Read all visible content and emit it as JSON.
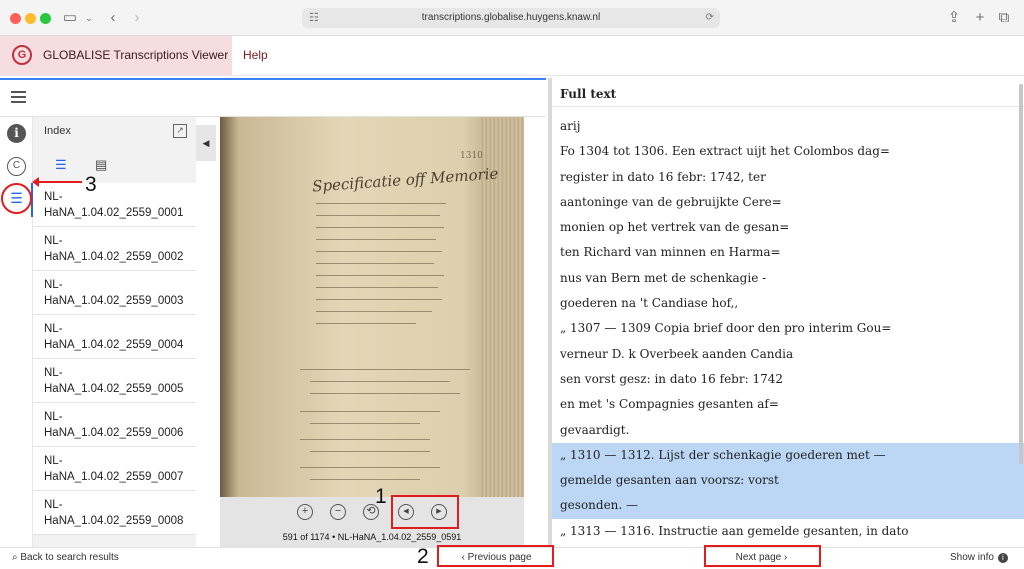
{
  "browser": {
    "url": "transcriptions.globalise.huygens.knaw.nl"
  },
  "app": {
    "title": "GLOBALISE Transcriptions Viewer",
    "logo_letter": "G",
    "help_label": "Help"
  },
  "index_panel": {
    "title": "Index",
    "items": [
      {
        "line1": "NL-",
        "line2": "HaNA_1.04.02_2559_0001"
      },
      {
        "line1": "NL-",
        "line2": "HaNA_1.04.02_2559_0002"
      },
      {
        "line1": "NL-",
        "line2": "HaNA_1.04.02_2559_0003"
      },
      {
        "line1": "NL-",
        "line2": "HaNA_1.04.02_2559_0004"
      },
      {
        "line1": "NL-",
        "line2": "HaNA_1.04.02_2559_0005"
      },
      {
        "line1": "NL-",
        "line2": "HaNA_1.04.02_2559_0006"
      },
      {
        "line1": "NL-",
        "line2": "HaNA_1.04.02_2559_0007"
      },
      {
        "line1": "NL-",
        "line2": "HaNA_1.04.02_2559_0008"
      }
    ]
  },
  "viewer": {
    "page_number_on_scan": "1310",
    "scan_heading": "Specificatie off Memorie",
    "caption": "591 of 1174 • NL-HaNA_1.04.02_2559_0591",
    "controls": {
      "zoom_in": "+",
      "zoom_out": "−",
      "reset": "⟲",
      "prev": "◀",
      "next": "▶"
    }
  },
  "full_text": {
    "title": "Full text",
    "lines": [
      {
        "text": "arij",
        "highlight": false
      },
      {
        "text": "Fo 1304 tot 1306. Een extract uijt het Colombos dag=",
        "highlight": false
      },
      {
        "text": "register in dato 16 febr: 1742, ter",
        "highlight": false
      },
      {
        "text": "aantoninge van de gebruijkte Cere=",
        "highlight": false
      },
      {
        "text": "monien op het vertrek van de gesan=",
        "highlight": false
      },
      {
        "text": "ten Richard van minnen en Harma=",
        "highlight": false
      },
      {
        "text": "nus van Bern met de schenkagie -",
        "highlight": false
      },
      {
        "text": "goederen na 't Candiase hof,,",
        "highlight": false
      },
      {
        "text": "„ 1307 — 1309 Copia brief door den pro interim Gou=",
        "highlight": false
      },
      {
        "text": "verneur D. k Overbeek aanden Candia",
        "highlight": false
      },
      {
        "text": "sen vorst gesz: in dato 16 febr: 1742",
        "highlight": false
      },
      {
        "text": "en met 's Compagnies gesanten af=",
        "highlight": false
      },
      {
        "text": "gevaardigt.",
        "highlight": false
      },
      {
        "text": "„ 1310 — 1312. Lijst der schenkagie goederen met —",
        "highlight": true
      },
      {
        "text": "gemelde gesanten aan voorsz: vorst",
        "highlight": true
      },
      {
        "text": "gesonden. —",
        "highlight": true
      },
      {
        "text": "„ 1313 — 1316. Instructie aan gemelde gesanten, in dato",
        "highlight": false
      }
    ]
  },
  "footer": {
    "back_label": "Back to search results",
    "prev_label": "Previous page",
    "next_label": "Next page",
    "info_label": "Show info"
  },
  "annotations": {
    "label_1": "1",
    "label_2": "2",
    "label_3": "3",
    "color": "#e11d1d"
  },
  "colors": {
    "accent": "#2563eb",
    "brand_bg": "#f6dde0",
    "brand_red": "#c0303f",
    "highlight": "#bcd7f6"
  }
}
